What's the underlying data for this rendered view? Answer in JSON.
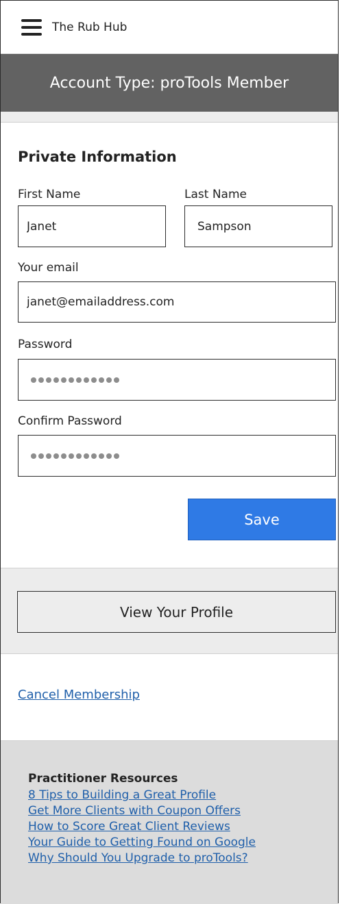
{
  "header": {
    "app_title": "The Rub Hub",
    "menu_icon": "hamburger-menu-icon"
  },
  "account_banner": {
    "text": "Account Type: proTools Member"
  },
  "private_info": {
    "title": "Private Information",
    "first_name_label": "First Name",
    "first_name_value": "Janet",
    "last_name_label": "Last Name",
    "last_name_value": "Sampson",
    "email_label": "Your email",
    "email_value": "janet@emailaddress.com",
    "password_label": "Password",
    "password_mask_length": 12,
    "confirm_password_label": "Confirm Password",
    "confirm_password_mask_length": 12,
    "save_label": "Save"
  },
  "profile": {
    "view_profile_label": "View Your Profile"
  },
  "membership": {
    "cancel_label": "Cancel Membership"
  },
  "resources": {
    "title": "Practitioner Resources",
    "links": [
      "8 Tips to Building a Great Profile",
      "Get More Clients with Coupon Offers",
      "How to Score Great Client Reviews",
      "Your Guide to Getting Found on Google",
      "Why Should You Upgrade to proTools?"
    ]
  },
  "colors": {
    "banner_bg": "#626262",
    "save_button": "#2f7ae5",
    "link": "#1f5faa",
    "resources_bg": "#dcdcdc"
  }
}
